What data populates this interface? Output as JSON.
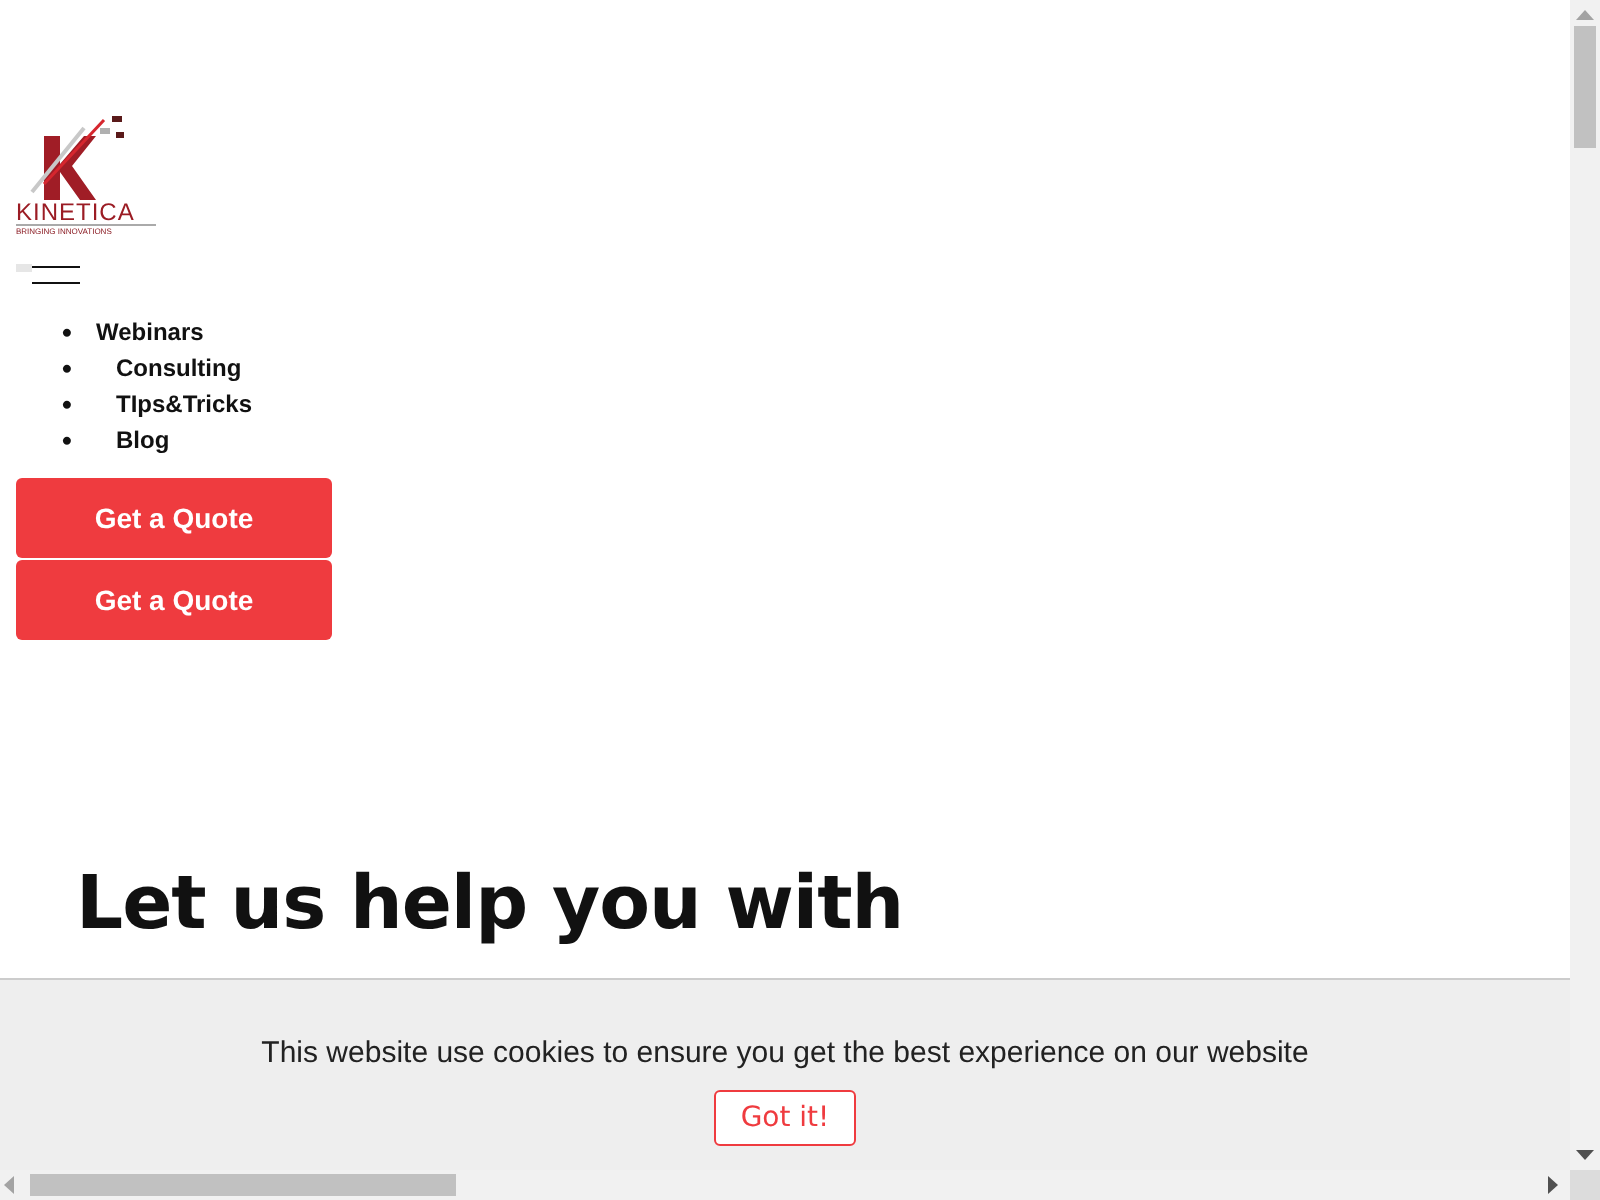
{
  "logo": {
    "name": "KINETICA",
    "tagline": "BRINGING INNOVATIONS"
  },
  "nav": {
    "items": [
      {
        "bullet": "•",
        "label": "Webinars"
      },
      {
        "bullet": "•",
        "label": "Consulting"
      },
      {
        "bullet": "•",
        "label": "TIps&Tricks"
      },
      {
        "bullet": "•",
        "label": "Blog"
      }
    ]
  },
  "quote_buttons": [
    "Get a Quote",
    "Get a Quote"
  ],
  "hero": {
    "heading": "Let us help you with"
  },
  "cookie_banner": {
    "message": "This website use cookies to ensure you get the best experience on our website",
    "button": "Got it!"
  }
}
